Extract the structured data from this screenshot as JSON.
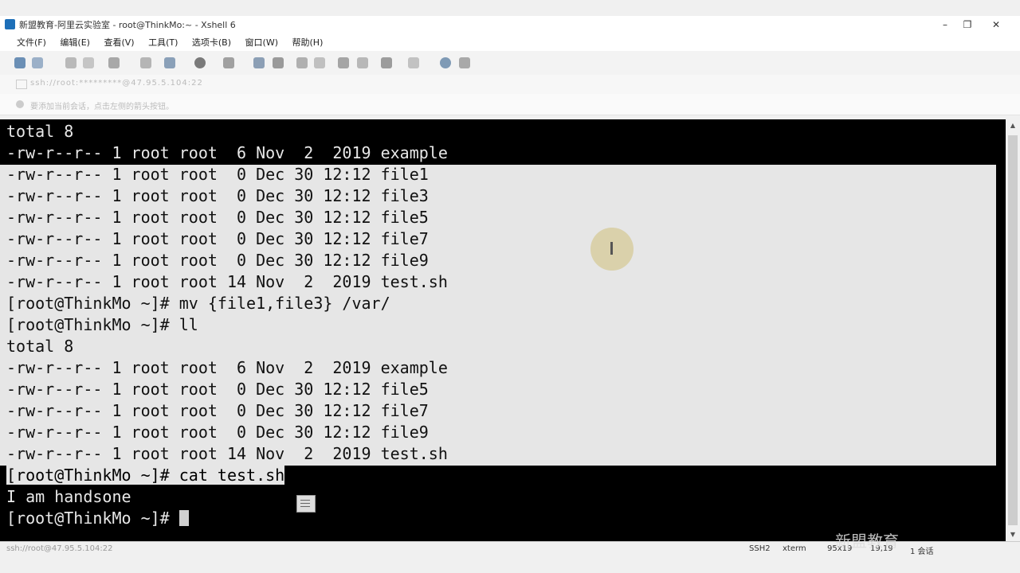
{
  "window": {
    "title": "新盟教育-阿里云实验室 - root@ThinkMo:~ - Xshell 6",
    "controls": [
      "–",
      "❐",
      "✕"
    ]
  },
  "menu": [
    "文件(F)",
    "编辑(E)",
    "查看(V)",
    "工具(T)",
    "选项卡(B)",
    "窗口(W)",
    "帮助(H)"
  ],
  "address": "ssh://root:*********@47.95.5.104:22",
  "hint": "要添加当前会话，点击左侧的箭头按钮。",
  "terminal": {
    "lines": [
      "total 8",
      "-rw-r--r-- 1 root root  6 Nov  2  2019 example",
      "-rw-r--r-- 1 root root  0 Dec 30 12:12 file1",
      "-rw-r--r-- 1 root root  0 Dec 30 12:12 file3",
      "-rw-r--r-- 1 root root  0 Dec 30 12:12 file5",
      "-rw-r--r-- 1 root root  0 Dec 30 12:12 file7",
      "-rw-r--r-- 1 root root  0 Dec 30 12:12 file9",
      "-rw-r--r-- 1 root root 14 Nov  2  2019 test.sh",
      "[root@ThinkMo ~]# mv {file1,file3} /var/",
      "[root@ThinkMo ~]# ll",
      "total 8",
      "-rw-r--r-- 1 root root  6 Nov  2  2019 example",
      "-rw-r--r-- 1 root root  0 Dec 30 12:12 file5",
      "-rw-r--r-- 1 root root  0 Dec 30 12:12 file7",
      "-rw-r--r-- 1 root root  0 Dec 30 12:12 file9",
      "-rw-r--r-- 1 root root 14 Nov  2  2019 test.sh",
      "[root@ThinkMo ~]# cat test.sh",
      "I am handsone",
      "[root@ThinkMo ~]# "
    ]
  },
  "status": {
    "left": "ssh://root@47.95.5.104:22",
    "protocol": "SSH2",
    "term": "xterm",
    "size": "95x19",
    "pos": "19,19",
    "sessions": "1 会话"
  },
  "watermark": "新盟教育"
}
